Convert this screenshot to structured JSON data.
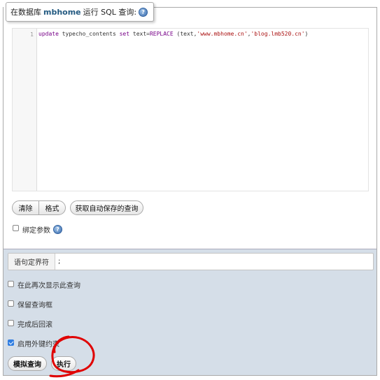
{
  "legend": {
    "prefix": "在数据库",
    "db_name": "mbhome",
    "suffix": "运行 SQL 查询:",
    "help_glyph": "?"
  },
  "editor": {
    "line_number": "1",
    "tokens": {
      "update": "update",
      "table": " typecho_contents ",
      "set": "set",
      "mid": " text=",
      "fn": "REPLACE",
      "args_open": " (text,",
      "arg1": "'www.mbhome.cn'",
      "comma": ",",
      "arg2": "'blog.lmb520.cn'",
      "close": ")"
    }
  },
  "editor_buttons": {
    "clear": "清除",
    "format": "格式",
    "autosave": "获取自动保存的查询"
  },
  "bind_params": {
    "label": "绑定参数",
    "checked": false
  },
  "options": {
    "delimiter_label": "语句定界符",
    "delimiter_value": ";",
    "show_again": {
      "label": "在此再次显示此查询",
      "checked": false
    },
    "keep_box": {
      "label": "保留查询框",
      "checked": false
    },
    "rollback": {
      "label": "完成后回滚",
      "checked": false
    },
    "foreign_keys": {
      "label": "启用外键约束",
      "checked": true
    }
  },
  "actions": {
    "simulate": "模拟查询",
    "go": "执行"
  },
  "colors": {
    "accent": "#235a81",
    "annotation": "#e00000",
    "options_bg": "#d5dee8"
  }
}
